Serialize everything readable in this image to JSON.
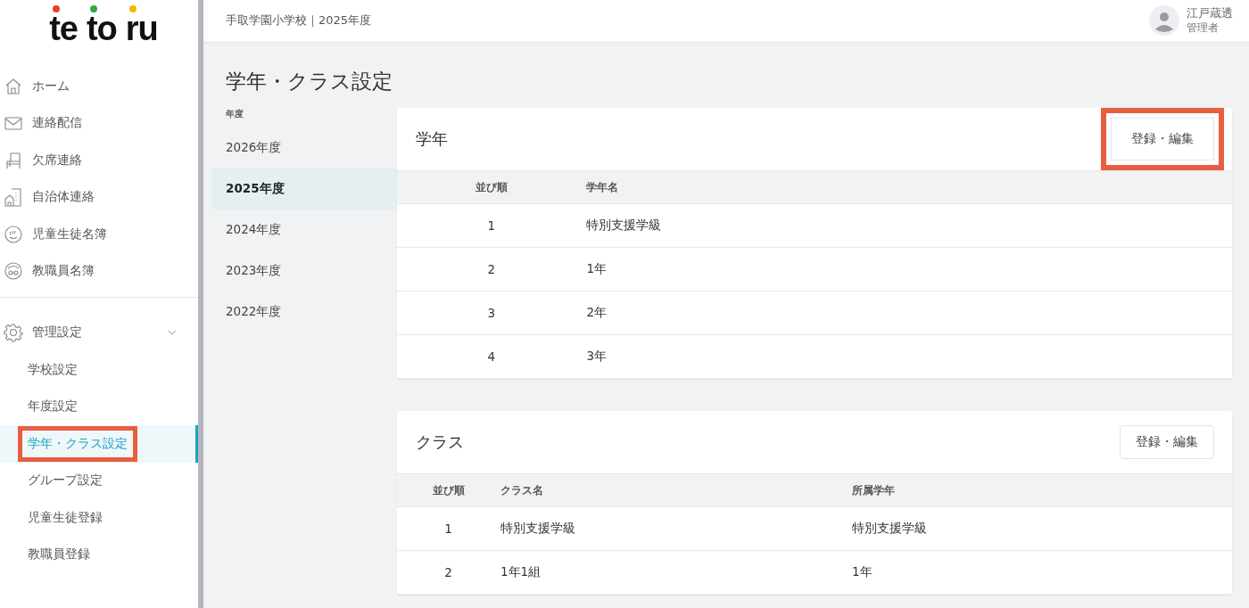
{
  "logo": {
    "parts": [
      {
        "text": "te",
        "color": "#ee3b2b"
      },
      {
        "text": "to",
        "color": "#2fab3c"
      },
      {
        "text": "ru",
        "color": "#f7b500"
      }
    ]
  },
  "sidebar": {
    "items": [
      {
        "label": "ホーム"
      },
      {
        "label": "連絡配信"
      },
      {
        "label": "欠席連絡"
      },
      {
        "label": "自治体連絡"
      },
      {
        "label": "児童生徒名簿"
      },
      {
        "label": "教職員名簿"
      }
    ],
    "group": {
      "label": "管理設定",
      "expanded": true,
      "children": [
        {
          "label": "学校設定",
          "selected": false,
          "highlighted": false
        },
        {
          "label": "年度設定",
          "selected": false,
          "highlighted": false
        },
        {
          "label": "学年・クラス設定",
          "selected": true,
          "highlighted": true
        },
        {
          "label": "グループ設定",
          "selected": false,
          "highlighted": false
        },
        {
          "label": "児童生徒登録",
          "selected": false,
          "highlighted": false
        },
        {
          "label": "教職員登録",
          "selected": false,
          "highlighted": false
        }
      ]
    }
  },
  "header": {
    "school": "手取学園小学校｜2025年度",
    "user_name": "江戸蔵透",
    "user_role": "管理者"
  },
  "page_title": "学年・クラス設定",
  "years": {
    "label": "年度",
    "items": [
      {
        "label": "2026年度",
        "selected": false
      },
      {
        "label": "2025年度",
        "selected": true
      },
      {
        "label": "2024年度",
        "selected": false
      },
      {
        "label": "2023年度",
        "selected": false
      },
      {
        "label": "2022年度",
        "selected": false
      }
    ]
  },
  "cards": [
    {
      "title": "学年",
      "button": "登録・編集",
      "highlighted": true,
      "columns": [
        "並び順",
        "学年名"
      ],
      "rows": [
        [
          "1",
          "特別支援学級"
        ],
        [
          "2",
          "1年"
        ],
        [
          "3",
          "2年"
        ],
        [
          "4",
          "3年"
        ]
      ]
    },
    {
      "title": "クラス",
      "button": "登録・編集",
      "highlighted": false,
      "columns": [
        "並び順",
        "クラス名",
        "所属学年"
      ],
      "rows": [
        [
          "1",
          "特別支援学級",
          "特別支援学級"
        ],
        [
          "2",
          "1年1組",
          "1年"
        ]
      ]
    }
  ]
}
